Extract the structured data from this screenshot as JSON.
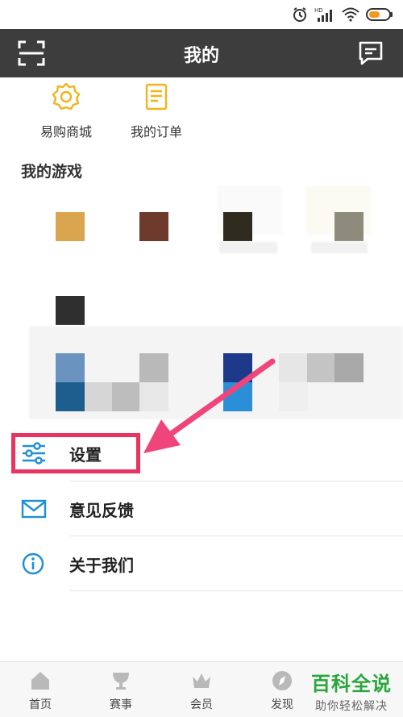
{
  "header": {
    "title": "我的"
  },
  "shortcuts": [
    {
      "label": "易购商城",
      "icon": "store-badge-icon"
    },
    {
      "label": "我的订单",
      "icon": "order-document-icon"
    }
  ],
  "games": {
    "title": "我的游戏"
  },
  "menu": {
    "settings": "设置",
    "feedback": "意见反馈",
    "about": "关于我们"
  },
  "bottom_nav": [
    {
      "label": "首页"
    },
    {
      "label": "赛事"
    },
    {
      "label": "会员"
    },
    {
      "label": "发现"
    }
  ],
  "watermark": {
    "main": "百科全说",
    "sub": "助你轻松解决"
  },
  "colors": {
    "accent": "#f3b31a",
    "menu_icon": "#1d8fd8",
    "highlight": "#e8345f",
    "app_bar": "#3d3d3d",
    "watermark": "#2aa63c"
  }
}
